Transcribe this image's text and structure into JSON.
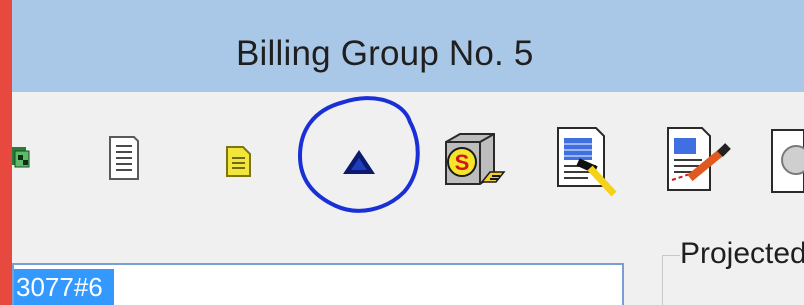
{
  "window": {
    "title": "Billing Group No. 5"
  },
  "toolbar": {
    "buttons": [
      {
        "name": "cards-icon"
      },
      {
        "name": "document-icon"
      },
      {
        "name": "note-icon"
      },
      {
        "name": "up-arrow-icon",
        "highlighted": true
      },
      {
        "name": "sorting-box-icon"
      },
      {
        "name": "report-hammer-icon"
      },
      {
        "name": "edit-document-icon"
      },
      {
        "name": "clear-icon"
      }
    ],
    "annotation_color": "#1a2fd6"
  },
  "projected_group": {
    "label": "Projected"
  },
  "input_field": {
    "selected_text": "3077#6"
  }
}
